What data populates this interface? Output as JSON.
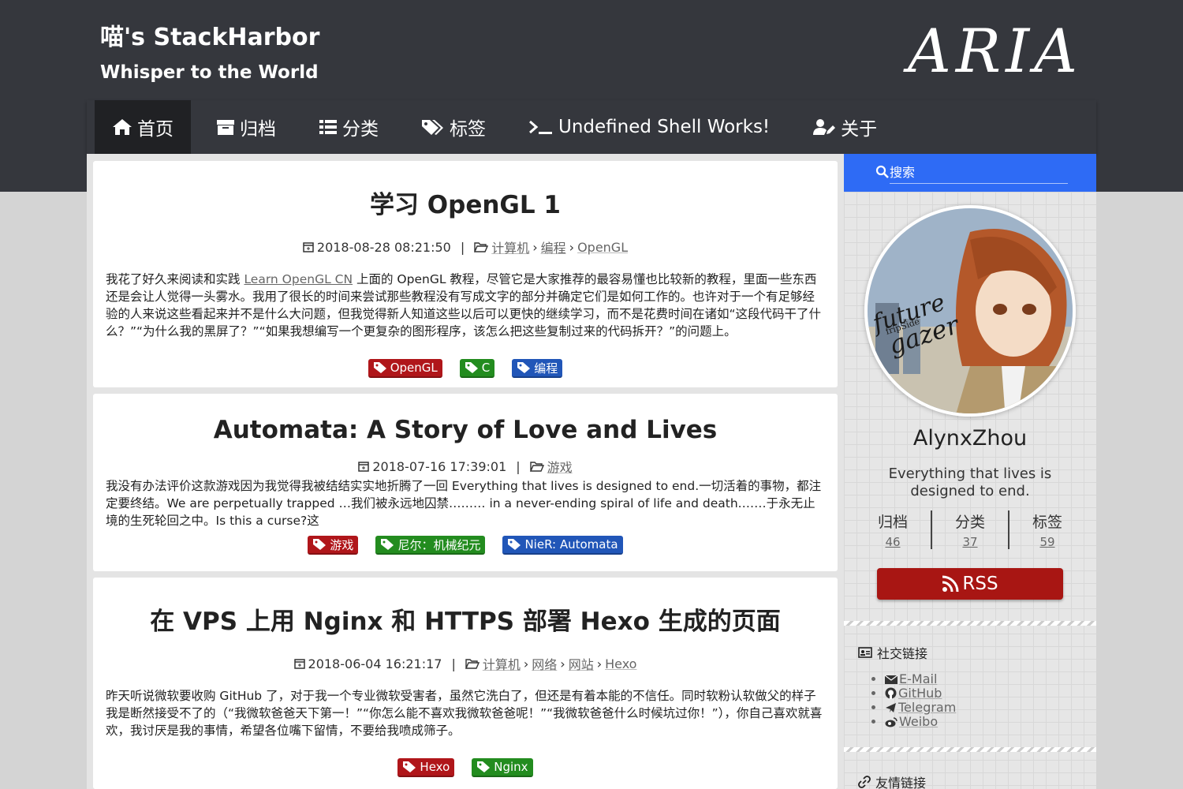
{
  "site": {
    "title": "喵's StackHarbor",
    "subtitle": "Whisper to the World",
    "logo": "ARIA"
  },
  "nav": [
    {
      "label": "首页",
      "icon": "home-icon",
      "active": true
    },
    {
      "label": "归档",
      "icon": "archive-icon"
    },
    {
      "label": "分类",
      "icon": "list-icon"
    },
    {
      "label": "标签",
      "icon": "tags-icon"
    },
    {
      "label": "Undefined Shell Works!",
      "icon": "terminal-icon"
    },
    {
      "label": "关于",
      "icon": "user-edit-icon"
    }
  ],
  "posts": [
    {
      "title": "学习 OpenGL 1",
      "date": "2018-08-28 08:21:50",
      "categories": [
        "计算机",
        "编程",
        "OpenGL"
      ],
      "excerpt_pre": "我花了好久来阅读和实践 ",
      "excerpt_link": "Learn OpenGL CN",
      "excerpt_post": " 上面的 OpenGL 教程，尽管它是大家推荐的最容易懂也比较新的教程，里面一些东西还是会让人觉得一头雾水。我用了很长的时间来尝试那些教程没有写成文字的部分并确定它们是如何工作的。也许对于一个有足够经验的人来说这些看起来并不是什么大问题，但我觉得新人知道这些以后可以更快的继续学习，而不是花费时间在诸如“这段代码干了什么？”“为什么我的黑屏了？”“如果我想编写一个更复杂的图形程序，该怎么把这些复制过来的代码拆开？”的问题上。",
      "tags": [
        "OpenGL",
        "C",
        "编程"
      ]
    },
    {
      "title": "Automata: A Story of Love and Lives",
      "date": "2018-07-16 17:39:01",
      "categories": [
        "游戏"
      ],
      "excerpt": "我没有办法评价这款游戏因为我觉得我被结结实实地折腾了一回 Everything that lives is designed to end.一切活着的事物，都注定要终结。We are perpetually trapped …我们被永远地囚禁……… in a never-ending spiral of life and death.……于永无止境的生死轮回之中。Is this a curse?这",
      "tags": [
        "游戏",
        "尼尔：机械纪元",
        "NieR: Automata"
      ]
    },
    {
      "title": "在 VPS 上用 Nginx 和 HTTPS 部署 Hexo 生成的页面",
      "date": "2018-06-04 16:21:17",
      "categories": [
        "计算机",
        "网络",
        "网站",
        "Hexo"
      ],
      "excerpt": "昨天听说微软要收购 GitHub 了，对于我一个专业微软受害者，虽然它洗白了，但还是有着本能的不信任。同时软粉认软做父的样子我是断然接受不了的（“我微软爸爸天下第一！”“你怎么能不喜欢我微软爸爸呢！”“我微软爸爸什么时候坑过你！”），你自己喜欢就喜欢，我讨厌是我的事情，希望各位嘴下留情，不要给我喷成筛子。",
      "tags": [
        "Hexo",
        "Nginx"
      ]
    }
  ],
  "sidebar": {
    "search_placeholder": "搜索",
    "author": "AlynxZhou",
    "motto": "Everything that lives is designed to end.",
    "stats": [
      {
        "label": "归档",
        "value": "46"
      },
      {
        "label": "分类",
        "value": "37"
      },
      {
        "label": "标签",
        "value": "59"
      }
    ],
    "rss": "RSS",
    "social_title": "社交链接",
    "social": [
      {
        "label": "E-Mail",
        "icon": "envelope-icon"
      },
      {
        "label": "GitHub",
        "icon": "github-icon"
      },
      {
        "label": "Telegram",
        "icon": "paper-plane-icon"
      },
      {
        "label": "Weibo",
        "icon": "weibo-icon"
      }
    ],
    "friends_title": "友情链接"
  },
  "colors": {
    "header": "#35373d",
    "search": "#2e6bf5",
    "rss": "#a81613",
    "tag_red": "#b0161a",
    "tag_green": "#238c1f",
    "tag_blue": "#2156b8"
  }
}
